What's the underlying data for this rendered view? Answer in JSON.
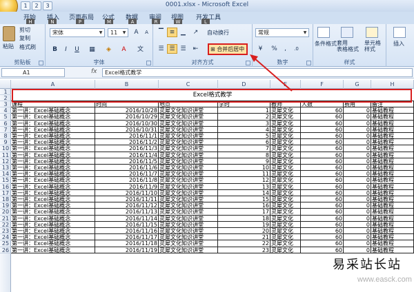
{
  "window": {
    "title": "0001.xlsx - Microsoft Excel"
  },
  "qat": {
    "keytip1": "1",
    "keytip2": "2",
    "keytip3": "3"
  },
  "tabs": [
    {
      "label": "开始",
      "keytip": "H"
    },
    {
      "label": "插入",
      "keytip": "N"
    },
    {
      "label": "页面布局",
      "keytip": "P"
    },
    {
      "label": "公式",
      "keytip": "M"
    },
    {
      "label": "数据",
      "keytip": "A"
    },
    {
      "label": "审阅",
      "keytip": "R"
    },
    {
      "label": "视图",
      "keytip": "W"
    },
    {
      "label": "开发工具",
      "keytip": "L"
    }
  ],
  "ribbon": {
    "clipboard": {
      "paste": "粘贴",
      "cut": "剪切",
      "copy": "复制",
      "format_painter": "格式刷",
      "label": "剪贴板"
    },
    "font": {
      "name": "宋体",
      "size": "11",
      "label": "字体"
    },
    "alignment": {
      "wrap": "自动换行",
      "merge": "合并后居中",
      "label": "对齐方式"
    },
    "number": {
      "format": "常规",
      "label": "数字"
    },
    "styles": {
      "conditional": "条件格式",
      "table": "套用\n表格格式",
      "cell": "单元格\n样式",
      "label": "样式"
    },
    "cells": {
      "insert": "插入"
    }
  },
  "formula_bar": {
    "name_box": "A1",
    "fx": "fx",
    "value": "Excel格式教学"
  },
  "columns": [
    "A",
    "B",
    "C",
    "D",
    "E",
    "F",
    "G",
    "H"
  ],
  "sheet": {
    "title": "Excel格式教学",
    "headers": [
      "课程",
      "时间",
      "地点",
      "学时",
      "教师",
      "人数",
      "费用",
      "备注"
    ],
    "rows": [
      [
        "第一讲：Excel基础概念",
        "2016/10/28",
        "灵犀文化知识讲堂",
        "1",
        "灵犀文化",
        "60",
        "0",
        "基础教程"
      ],
      [
        "第一讲：Excel基础概念",
        "2016/10/29",
        "灵犀文化知识讲堂",
        "2",
        "灵犀文化",
        "60",
        "0",
        "基础教程"
      ],
      [
        "第一讲：Excel基础概念",
        "2016/10/30",
        "灵犀文化知识讲堂",
        "3",
        "灵犀文化",
        "60",
        "0",
        "基础教程"
      ],
      [
        "第一讲：Excel基础概念",
        "2016/10/31",
        "灵犀文化知识讲堂",
        "4",
        "灵犀文化",
        "60",
        "0",
        "基础教程"
      ],
      [
        "第一讲：Excel基础概念",
        "2016/11/1",
        "灵犀文化知识讲堂",
        "5",
        "灵犀文化",
        "60",
        "0",
        "基础教程"
      ],
      [
        "第一讲：Excel基础概念",
        "2016/11/2",
        "灵犀文化知识讲堂",
        "6",
        "灵犀文化",
        "60",
        "0",
        "基础教程"
      ],
      [
        "第一讲：Excel基础概念",
        "2016/11/3",
        "灵犀文化知识讲堂",
        "7",
        "灵犀文化",
        "60",
        "0",
        "基础教程"
      ],
      [
        "第一讲：Excel基础概念",
        "2016/11/4",
        "灵犀文化知识讲堂",
        "8",
        "灵犀文化",
        "60",
        "0",
        "基础教程"
      ],
      [
        "第一讲：Excel基础概念",
        "2016/11/5",
        "灵犀文化知识讲堂",
        "9",
        "灵犀文化",
        "60",
        "0",
        "基础教程"
      ],
      [
        "第一讲：Excel基础概念",
        "2016/11/6",
        "灵犀文化知识讲堂",
        "10",
        "灵犀文化",
        "60",
        "0",
        "基础教程"
      ],
      [
        "第一讲：Excel基础概念",
        "2016/11/7",
        "灵犀文化知识讲堂",
        "11",
        "灵犀文化",
        "60",
        "0",
        "基础教程"
      ],
      [
        "第一讲：Excel基础概念",
        "2016/11/8",
        "灵犀文化知识讲堂",
        "12",
        "灵犀文化",
        "60",
        "0",
        "基础教程"
      ],
      [
        "第一讲：Excel基础概念",
        "2016/11/9",
        "灵犀文化知识讲堂",
        "13",
        "灵犀文化",
        "60",
        "0",
        "基础教程"
      ],
      [
        "第一讲：Excel基础概念",
        "2016/11/10",
        "灵犀文化知识讲堂",
        "14",
        "灵犀文化",
        "60",
        "0",
        "基础教程"
      ],
      [
        "第一讲：Excel基础概念",
        "2016/11/11",
        "灵犀文化知识讲堂",
        "15",
        "灵犀文化",
        "60",
        "0",
        "基础教程"
      ],
      [
        "第一讲：Excel基础概念",
        "2016/11/12",
        "灵犀文化知识讲堂",
        "16",
        "灵犀文化",
        "60",
        "0",
        "基础教程"
      ],
      [
        "第一讲：Excel基础概念",
        "2016/11/13",
        "灵犀文化知识讲堂",
        "17",
        "灵犀文化",
        "60",
        "0",
        "基础教程"
      ],
      [
        "第一讲：Excel基础概念",
        "2016/11/14",
        "灵犀文化知识讲堂",
        "18",
        "灵犀文化",
        "60",
        "0",
        "基础教程"
      ],
      [
        "第一讲：Excel基础概念",
        "2016/11/15",
        "灵犀文化知识讲堂",
        "19",
        "灵犀文化",
        "60",
        "0",
        "基础教程"
      ],
      [
        "第一讲：Excel基础概念",
        "2016/11/16",
        "灵犀文化知识讲堂",
        "20",
        "灵犀文化",
        "60",
        "0",
        "基础教程"
      ],
      [
        "第一讲：Excel基础概念",
        "2016/11/17",
        "灵犀文化知识讲堂",
        "21",
        "灵犀文化",
        "60",
        "0",
        "基础教程"
      ],
      [
        "第一讲：Excel基础概念",
        "2016/11/18",
        "灵犀文化知识讲堂",
        "22",
        "灵犀文化",
        "60",
        "0",
        "基础教程"
      ],
      [
        "第一讲：Excel基础概念",
        "2016/11/19",
        "灵犀文化知识讲堂",
        "23",
        "灵犀文化",
        "60",
        "0",
        "基础教程"
      ]
    ]
  },
  "row_numbers": [
    "1",
    "2",
    "3",
    "4",
    "5",
    "6",
    "7",
    "8",
    "9",
    "10",
    "11",
    "12",
    "13",
    "14",
    "15",
    "16",
    "17",
    "18",
    "19",
    "20",
    "21",
    "22",
    "23",
    "24",
    "25",
    "26"
  ],
  "watermark": {
    "line1": "易采站长站",
    "line2": "www.easck.com"
  },
  "colors": {
    "highlight_red": "#d81e1e",
    "ribbon_blue": "#d6e4f5"
  }
}
